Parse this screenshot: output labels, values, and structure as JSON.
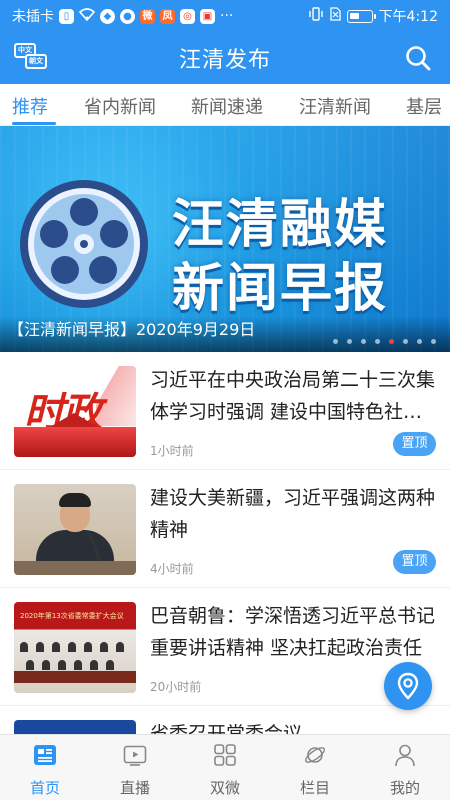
{
  "status_bar": {
    "carrier": "未插卡",
    "more": "···",
    "time": "下午4:12"
  },
  "header": {
    "lang_top": "中文",
    "lang_bottom": "朝文",
    "title": "汪清发布"
  },
  "tabs": [
    {
      "label": "推荐",
      "active": true
    },
    {
      "label": "省内新闻",
      "active": false
    },
    {
      "label": "新闻速递",
      "active": false
    },
    {
      "label": "汪清新闻",
      "active": false
    },
    {
      "label": "基层",
      "active": false
    }
  ],
  "banner": {
    "line1": "汪清融媒",
    "line2": "新闻早报",
    "caption": "【汪清新闻早报】2020年9月29日",
    "dot_count": 8,
    "active_dot": 4
  },
  "news": [
    {
      "title": "习近平在中央政治局第二十三次集体学习时强调 建设中国特色社会主义",
      "thumb_word": "时政",
      "time": "1小时前",
      "pinned_label": "置顶"
    },
    {
      "title": "建设大美新疆，习近平强调这两种精神",
      "time": "4小时前",
      "pinned_label": "置顶"
    },
    {
      "title": "巴音朝鲁：学深悟透习近平总书记重要讲话精神 坚决扛起政治责任",
      "thumb_banner": "2020年第13次省委常委扩大会议",
      "time": "20小时前"
    },
    {
      "title": "省委召开常委会议"
    }
  ],
  "bottom_nav": [
    {
      "label": "首页",
      "icon": "home-news-icon",
      "active": true
    },
    {
      "label": "直播",
      "icon": "live-video-icon",
      "active": false
    },
    {
      "label": "双微",
      "icon": "grid-apps-icon",
      "active": false
    },
    {
      "label": "栏目",
      "icon": "planet-icon",
      "active": false
    },
    {
      "label": "我的",
      "icon": "person-icon",
      "active": false
    }
  ],
  "colors": {
    "primary": "#2f93f2",
    "pin_badge": "#4aa3f5",
    "active_dot": "#ff3b3b"
  }
}
